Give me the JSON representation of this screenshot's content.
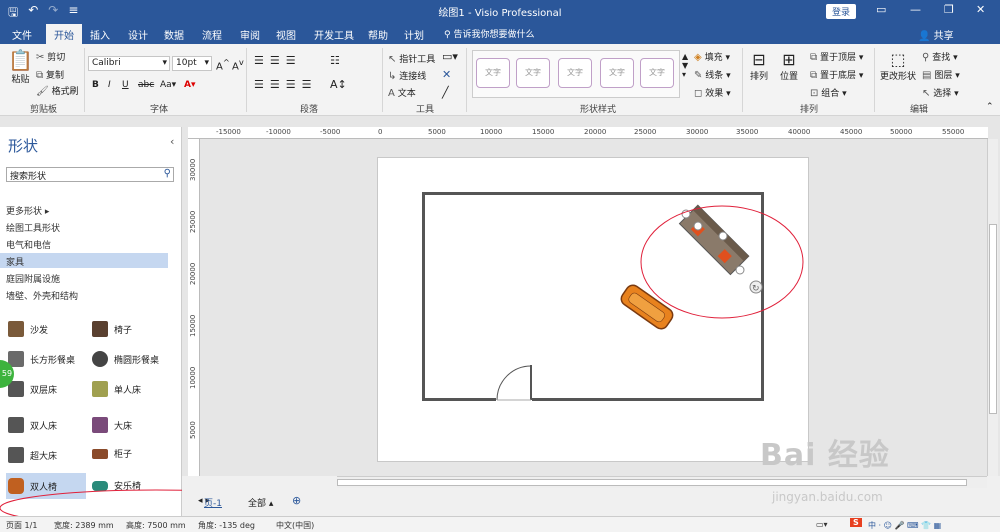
{
  "title_bar": {
    "title": "绘图1  -  Visio Professional",
    "login_label": "登录"
  },
  "tabs": [
    "文件",
    "开始",
    "插入",
    "设计",
    "数据",
    "流程",
    "审阅",
    "视图",
    "开发工具",
    "帮助",
    "计划"
  ],
  "active_tab": "开始",
  "tell_me": "告诉我你想要做什么",
  "share_label": "共享",
  "ribbon": {
    "clipboard": {
      "paste": "粘贴",
      "cut": "剪切",
      "copy": "复制",
      "format_painter": "格式刷",
      "group": "剪贴板"
    },
    "font": {
      "name": "Calibri",
      "size": "10pt",
      "group": "字体"
    },
    "paragraph": {
      "group": "段落"
    },
    "tools": {
      "pointer": "指针工具",
      "connector": "连接线",
      "text": "文本",
      "group": "工具"
    },
    "styles": {
      "sample": "文字",
      "group": "形状样式",
      "fill": "填充",
      "line": "线条",
      "effect": "效果"
    },
    "arrange": {
      "arrange": "排列",
      "position": "位置",
      "bring_front": "置于顶层",
      "send_back": "置于底层",
      "group_cmd": "组合",
      "group": "排列"
    },
    "edit": {
      "change_shape": "更改形状",
      "find": "查找",
      "layers": "图层",
      "select": "选择",
      "group": "编辑"
    }
  },
  "sidebar": {
    "title": "形状",
    "search_value": "搜索形状",
    "categories": [
      "更多形状",
      "绘图工具形状",
      "电气和电信",
      "家具",
      "庭园附属设施",
      "墙壁、外壳和结构"
    ],
    "selected_category": "家具",
    "shapes": [
      {
        "label": "沙发",
        "color": "#7a5a3a"
      },
      {
        "label": "椅子",
        "color": "#5a4030"
      },
      {
        "label": "长方形餐桌",
        "color": "#6a6a6a"
      },
      {
        "label": "椭圆形餐桌",
        "color": "#444444"
      },
      {
        "label": "双层床",
        "color": "#555555"
      },
      {
        "label": "单人床",
        "color": "#a0a050"
      },
      {
        "label": "双人床",
        "color": "#555555"
      },
      {
        "label": "大床",
        "color": "#7a4a7a"
      },
      {
        "label": "超大床",
        "color": "#555555"
      },
      {
        "label": "柜子",
        "color": "#8a4a2a"
      },
      {
        "label": "双人椅",
        "color": "#c06020"
      },
      {
        "label": "安乐椅",
        "color": "#2a8a7a"
      }
    ],
    "selected_shape": "双人椅",
    "badge": "59"
  },
  "ruler": {
    "h_ticks": [
      "-15000",
      "-10000",
      "-5000",
      "0",
      "5000",
      "10000",
      "15000",
      "20000",
      "25000",
      "30000",
      "35000",
      "40000",
      "45000",
      "50000",
      "55000"
    ],
    "v_ticks": [
      "30000",
      "25000",
      "20000",
      "15000",
      "10000",
      "5000"
    ]
  },
  "pages": {
    "current": "页-1",
    "all": "全部"
  },
  "status_bar": {
    "page": "页面 1/1",
    "width": "宽度: 2389 mm",
    "height": "高度: 7500 mm",
    "angle": "角度: -135 deg",
    "language": "中文(中国)"
  },
  "watermark": {
    "logo": "Bai 经验",
    "url": "jingyan.baidu.com"
  },
  "colors": {
    "accent": "#2b579a",
    "annotation": "#e0203a",
    "furniture_orange": "#e8821e",
    "sofa_gray": "#8a7a6a"
  }
}
